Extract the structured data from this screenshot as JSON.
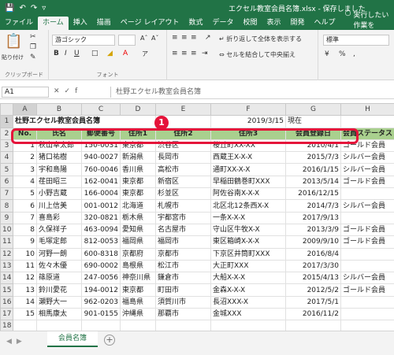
{
  "titlebar": {
    "document": "エクセル教室会員名簿.xlsx - 保存しました"
  },
  "menu": [
    "ファイル",
    "ホーム",
    "挿入",
    "描画",
    "ページ レイアウト",
    "数式",
    "データ",
    "校閲",
    "表示",
    "開発",
    "ヘルプ"
  ],
  "tell_me": "実行したい作業を",
  "ribbon": {
    "clipboard_label": "クリップボード",
    "paste_label": "貼り付け",
    "font_name": "游ゴシック",
    "font_label": "フォント",
    "wrap_text": "折り返して全体を表示する",
    "merge_center": "セルを結合して中央揃え",
    "number_format": "標準"
  },
  "formula_bar": {
    "namebox": "A1",
    "formula": "杜野エクセル教室会員名簿"
  },
  "columns": [
    "A",
    "B",
    "C",
    "D",
    "E",
    "F",
    "G",
    "H"
  ],
  "title_cell": "杜野エクセル教室会員名簿",
  "date_cell": "2019/3/15",
  "date_suffix": "現在",
  "headers": [
    "No.",
    "氏名",
    "郵便番号",
    "住所1",
    "住所2",
    "住所3",
    "会員登録日",
    "会員ステータス"
  ],
  "rows": [
    [
      "1",
      "秋山幸太郎",
      "150-0031",
      "東京都",
      "渋谷区",
      "桜丘町XX-XX",
      "2010/4/1",
      "ゴールド会員"
    ],
    [
      "2",
      "猪口祐樹",
      "940-0027",
      "新潟県",
      "長岡市",
      "西蔵王X-X-X",
      "2015/7/3",
      "シルバー会員"
    ],
    [
      "3",
      "宇和島陽",
      "760-0046",
      "香川県",
      "高松市",
      "通町XX-X-X",
      "2016/1/15",
      "シルバー会員"
    ],
    [
      "4",
      "荏田昭三",
      "162-0041",
      "東京都",
      "新宿区",
      "早稲田鶴巻町XXX",
      "2013/5/14",
      "ゴールド会員"
    ],
    [
      "5",
      "小野吉蔵",
      "166-0004",
      "東京都",
      "杉並区",
      "阿佐谷南X-X-X",
      "2016/12/15",
      ""
    ],
    [
      "6",
      "川上信美",
      "001-0012",
      "北海道",
      "札幌市",
      "北区北12条西X-X",
      "2014/7/3",
      "シルバー会員"
    ],
    [
      "7",
      "喜島彩",
      "320-0821",
      "栃木県",
      "宇都宮市",
      "一条X-X-X",
      "2017/9/13",
      ""
    ],
    [
      "8",
      "久保祥子",
      "463-0094",
      "愛知県",
      "名古屋市",
      "守山区牛牧X-X",
      "2013/3/9",
      "ゴールド会員"
    ],
    [
      "9",
      "毛塚定郎",
      "812-0053",
      "福岡県",
      "福岡市",
      "東区箱崎X-X-X",
      "2009/9/10",
      "ゴールド会員"
    ],
    [
      "10",
      "河野一朗",
      "600-8318",
      "京都府",
      "京都市",
      "下京区井筒町XXX",
      "2016/8/4",
      ""
    ],
    [
      "11",
      "佐々木優",
      "690-0002",
      "島根県",
      "松江市",
      "大正町XXX",
      "2017/3/30",
      ""
    ],
    [
      "12",
      "篠原道",
      "247-0056",
      "神奈川県",
      "鎌倉市",
      "大船X-X-X",
      "2015/4/13",
      "シルバー会員"
    ],
    [
      "13",
      "鈴川愛花",
      "194-0012",
      "東京都",
      "町田市",
      "金森X-X-X",
      "2012/5/2",
      "ゴールド会員"
    ],
    [
      "14",
      "瀬野大一",
      "962-0203",
      "福島県",
      "須賀川市",
      "長沼XXX-X",
      "2017/5/1",
      ""
    ],
    [
      "15",
      "相馬康太",
      "901-0155",
      "沖縄県",
      "那覇市",
      "金城XXX",
      "2016/11/2",
      ""
    ]
  ],
  "row_numbers": [
    "1",
    "2",
    "3",
    "4",
    "5",
    "6",
    "7",
    "8",
    "9",
    "10",
    "11",
    "12",
    "13",
    "14",
    "15",
    "16",
    "17",
    "18"
  ],
  "callout": "1",
  "sheet_tab": "会員名簿",
  "colors": {
    "excel_green": "#217346",
    "header_fill": "#a9d08e",
    "callout_red": "#e5133a"
  }
}
